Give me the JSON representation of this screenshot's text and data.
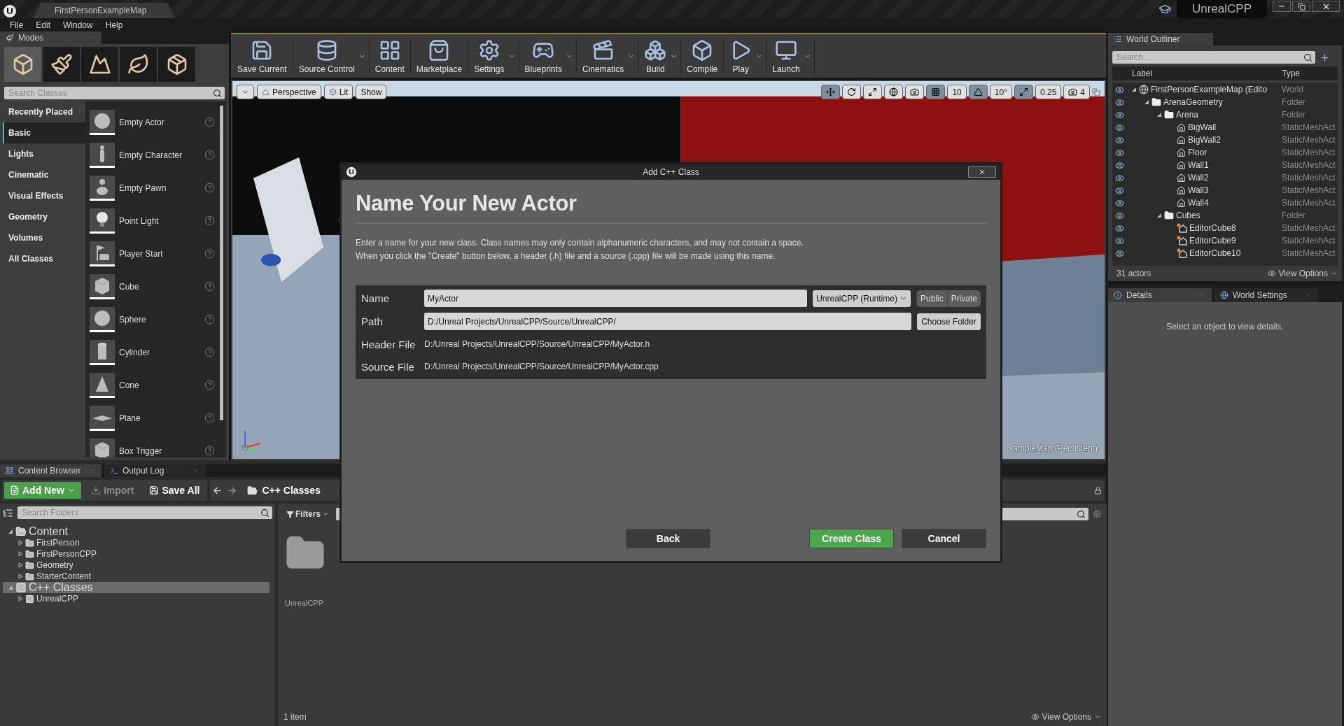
{
  "title_bar": {
    "tab": "FirstPersonExampleMap",
    "project": "UnrealCPP"
  },
  "menu": [
    "File",
    "Edit",
    "Window",
    "Help"
  ],
  "modes": {
    "tab": "Modes",
    "tools": [
      {
        "kind": "place",
        "selected": true
      },
      {
        "kind": "paint",
        "selected": false
      },
      {
        "kind": "landscape",
        "selected": false
      },
      {
        "kind": "foliage",
        "selected": false
      },
      {
        "kind": "geometry",
        "selected": false
      }
    ],
    "search_placeholder": "Search Classes",
    "categories": [
      {
        "label": "Recently Placed",
        "selected": false
      },
      {
        "label": "Basic",
        "selected": true
      },
      {
        "label": "Lights",
        "selected": false
      },
      {
        "label": "Cinematic",
        "selected": false
      },
      {
        "label": "Visual Effects",
        "selected": false
      },
      {
        "label": "Geometry",
        "selected": false
      },
      {
        "label": "Volumes",
        "selected": false
      },
      {
        "label": "All Classes",
        "selected": false
      }
    ],
    "items": [
      {
        "label": "Empty Actor",
        "kind": "sphere"
      },
      {
        "label": "Empty Character",
        "kind": "figure"
      },
      {
        "label": "Empty Pawn",
        "kind": "pawn"
      },
      {
        "label": "Point Light",
        "kind": "bulb"
      },
      {
        "label": "Player Start",
        "kind": "flag"
      },
      {
        "label": "Cube",
        "kind": "cube"
      },
      {
        "label": "Sphere",
        "kind": "sphere"
      },
      {
        "label": "Cylinder",
        "kind": "cylinder"
      },
      {
        "label": "Cone",
        "kind": "cone"
      },
      {
        "label": "Plane",
        "kind": "plane"
      },
      {
        "label": "Box Trigger",
        "kind": "cube"
      }
    ]
  },
  "toolbar": [
    {
      "label": "Save Current",
      "kind": "save",
      "dropdown": false
    },
    {
      "label": "Source Control",
      "kind": "source",
      "dropdown": true
    },
    {
      "label": "Content",
      "kind": "content",
      "dropdown": false
    },
    {
      "label": "Marketplace",
      "kind": "market",
      "dropdown": false
    },
    {
      "label": "Settings",
      "kind": "settings",
      "dropdown": true
    },
    {
      "label": "Blueprints",
      "kind": "blueprints",
      "dropdown": true
    },
    {
      "label": "Cinematics",
      "kind": "cinematics",
      "dropdown": true
    },
    {
      "label": "Build",
      "kind": "build",
      "dropdown": true
    },
    {
      "label": "Compile",
      "kind": "compile",
      "dropdown": false
    },
    {
      "label": "Play",
      "kind": "play",
      "dropdown": true
    },
    {
      "label": "Launch",
      "kind": "launch",
      "dropdown": true
    }
  ],
  "viewport": {
    "view": "Perspective",
    "lighting": "Lit",
    "show": "Show",
    "grid_snap": "10",
    "rotation_snap": "10°",
    "scale_snap": "0.25",
    "camera_speed": "4",
    "level_label": "xampleMap (Persistent)"
  },
  "outliner": {
    "tab": "World Outliner",
    "search_placeholder": "Search...",
    "columns": [
      "Label",
      "Type"
    ],
    "rows": [
      {
        "label": "FirstPersonExampleMap (Edito",
        "type": "World",
        "kind": "world",
        "expanded": true,
        "children": [
          {
            "label": "ArenaGeometry",
            "type": "Folder",
            "kind": "folder",
            "expanded": true,
            "children": [
              {
                "label": "Arena",
                "type": "Folder",
                "kind": "folder",
                "expanded": true,
                "children": [
                  {
                    "label": "BigWall",
                    "type": "StaticMeshAct",
                    "kind": "mesh"
                  },
                  {
                    "label": "BigWall2",
                    "type": "StaticMeshAct",
                    "kind": "mesh"
                  },
                  {
                    "label": "Floor",
                    "type": "StaticMeshAct",
                    "kind": "mesh"
                  },
                  {
                    "label": "Wall1",
                    "type": "StaticMeshAct",
                    "kind": "mesh"
                  },
                  {
                    "label": "Wall2",
                    "type": "StaticMeshAct",
                    "kind": "mesh"
                  },
                  {
                    "label": "Wall3",
                    "type": "StaticMeshAct",
                    "kind": "mesh"
                  },
                  {
                    "label": "Wall4",
                    "type": "StaticMeshAct",
                    "kind": "mesh"
                  }
                ]
              },
              {
                "label": "Cubes",
                "type": "Folder",
                "kind": "folder",
                "expanded": true,
                "children": [
                  {
                    "label": "EditorCube8",
                    "type": "StaticMeshAct",
                    "kind": "movable"
                  },
                  {
                    "label": "EditorCube9",
                    "type": "StaticMeshAct",
                    "kind": "movable"
                  },
                  {
                    "label": "EditorCube10",
                    "type": "StaticMeshAct",
                    "kind": "movable"
                  }
                ]
              }
            ]
          }
        ]
      }
    ],
    "count": "31 actors",
    "view_options": "View Options"
  },
  "details": {
    "tabs": [
      {
        "label": "Details",
        "kind": "details",
        "selected": true
      },
      {
        "label": "World Settings",
        "kind": "world",
        "selected": false
      }
    ],
    "message": "Select an object to view details."
  },
  "content_browser": {
    "tabs": [
      {
        "label": "Content Browser",
        "kind": "browser",
        "selected": true
      },
      {
        "label": "Output Log",
        "kind": "log",
        "selected": false
      }
    ],
    "add_new": "Add New",
    "import": {
      "label": "Import",
      "disabled": true
    },
    "save_all": "Save All",
    "path": "C++ Classes",
    "search_placeholder": "Search Folders",
    "tree": [
      {
        "label": "Content",
        "kind": "folder",
        "expanded": true,
        "selected": false,
        "children": [
          {
            "label": "FirstPerson",
            "kind": "folder",
            "expanded": false,
            "selected": false
          },
          {
            "label": "FirstPersonCPP",
            "kind": "folder",
            "expanded": false,
            "selected": false
          },
          {
            "label": "Geometry",
            "kind": "folder",
            "expanded": false,
            "selected": false
          },
          {
            "label": "StarterContent",
            "kind": "folder",
            "expanded": false,
            "selected": false
          }
        ]
      },
      {
        "label": "C++ Classes",
        "kind": "classes",
        "expanded": true,
        "selected": true,
        "children": [
          {
            "label": "UnrealCPP",
            "kind": "classes",
            "expanded": false,
            "selected": false
          }
        ]
      }
    ],
    "filters": "Filters",
    "assets": [
      {
        "label": "UnrealCPP"
      }
    ],
    "count": "1 item",
    "view_options": "View Options"
  },
  "dialog": {
    "title": "Add C++ Class",
    "heading": "Name Your New Actor",
    "description": [
      "Enter a name for your new class. Class names may only contain alphanumeric characters, and may not contain a space.",
      "When you click the \"Create\" button below, a header (.h) file and a source (.cpp) file will be made using this name."
    ],
    "name": {
      "label": "Name",
      "value": "MyActor"
    },
    "module": "UnrealCPP (Runtime)",
    "visibility": [
      {
        "label": "Public",
        "selected": false
      },
      {
        "label": "Private",
        "selected": false
      }
    ],
    "path": {
      "label": "Path",
      "value": "D:/Unreal Projects/UnrealCPP/Source/UnrealCPP/"
    },
    "choose_folder": "Choose Folder",
    "header": {
      "label": "Header File",
      "value": "D:/Unreal Projects/UnrealCPP/Source/UnrealCPP/MyActor.h"
    },
    "source": {
      "label": "Source File",
      "value": "D:/Unreal Projects/UnrealCPP/Source/UnrealCPP/MyActor.cpp"
    },
    "buttons": [
      {
        "label": "Back",
        "kind": "back"
      },
      {
        "label": "Create Class",
        "kind": "primary"
      },
      {
        "label": "Cancel",
        "kind": "normal"
      }
    ]
  }
}
